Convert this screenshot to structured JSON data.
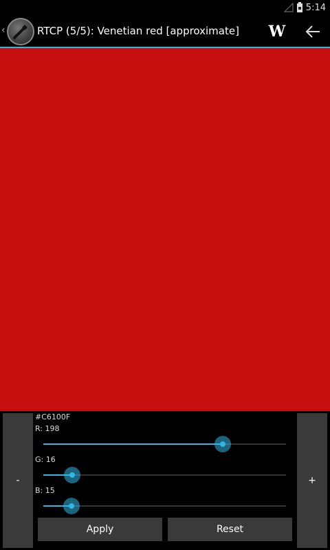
{
  "status_bar": {
    "time": "5:14"
  },
  "action_bar": {
    "title": "RTCP (5/5): Venetian red [approximate]",
    "wiki_label": "W"
  },
  "color": {
    "hex": "#C6100F",
    "r": 198,
    "g": 16,
    "b": 15
  },
  "sliders": {
    "r_label": "R: 198",
    "g_label": "G: 16",
    "b_label": "B: 15",
    "max": 255
  },
  "buttons": {
    "minus": "-",
    "plus": "+",
    "apply": "Apply",
    "reset": "Reset"
  },
  "colors": {
    "accent": "#33b5e5",
    "button_bg": "#3a3a3a"
  }
}
